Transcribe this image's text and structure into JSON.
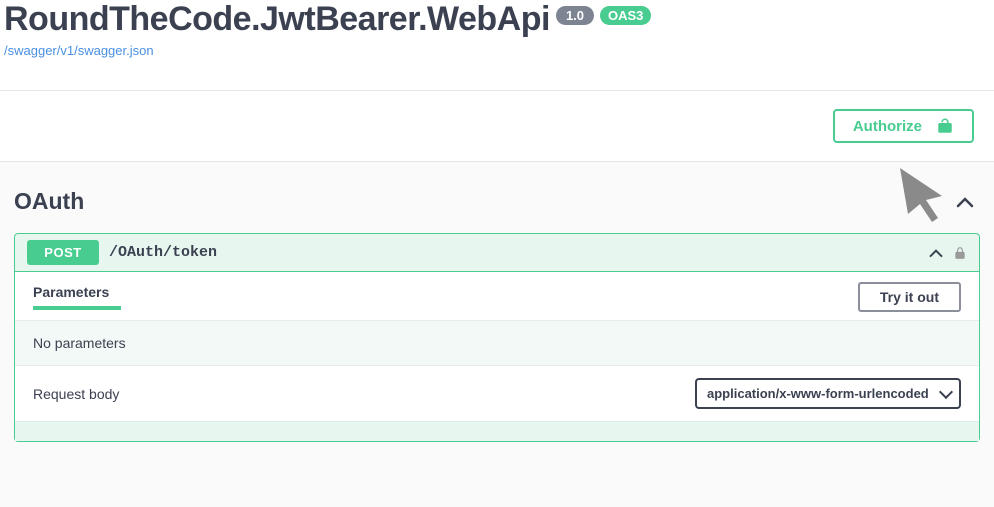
{
  "header": {
    "title": "RoundTheCode.JwtBearer.WebApi",
    "version": "1.0",
    "oas": "OAS3",
    "swagger_link": "/swagger/v1/swagger.json"
  },
  "authorize": {
    "label": "Authorize"
  },
  "tag": {
    "name": "OAuth"
  },
  "operation": {
    "method": "POST",
    "path": "/OAuth/token",
    "parameters_label": "Parameters",
    "try_label": "Try it out",
    "no_parameters": "No parameters",
    "request_body_label": "Request body",
    "content_type": "application/x-www-form-urlencoded"
  }
}
